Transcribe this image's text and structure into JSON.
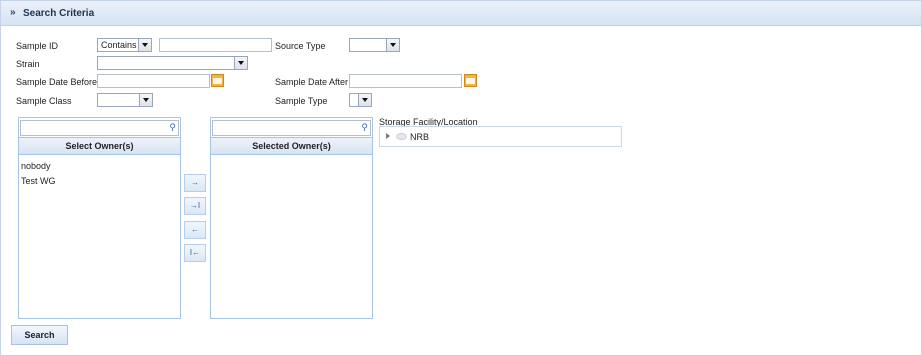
{
  "header": {
    "title": "Search Criteria",
    "collapse_icon": "double-chevron-down-icon"
  },
  "form": {
    "sample_id_label": "Sample ID",
    "sample_id_operator": "Contains",
    "sample_id_value": "",
    "source_type_label": "Source Type",
    "source_type_value": "",
    "strain_label": "Strain",
    "strain_value": "",
    "sample_date_before_label": "Sample Date Before",
    "sample_date_before_value": "",
    "sample_date_after_label": "Sample Date After",
    "sample_date_after_value": "",
    "sample_class_label": "Sample Class",
    "sample_class_value": "",
    "sample_type_label": "Sample Type",
    "sample_type_value": ""
  },
  "owners": {
    "available_header": "Select Owner(s)",
    "selected_header": "Selected Owner(s)",
    "available": [
      "nobody",
      "Test WG"
    ],
    "selected": [],
    "move_buttons": [
      "→",
      "→I",
      "←",
      "I←"
    ]
  },
  "storage": {
    "label": "Storage Facility/Location",
    "tree": [
      {
        "label": "NRB",
        "expanded": false
      }
    ]
  },
  "search_button": "Search"
}
